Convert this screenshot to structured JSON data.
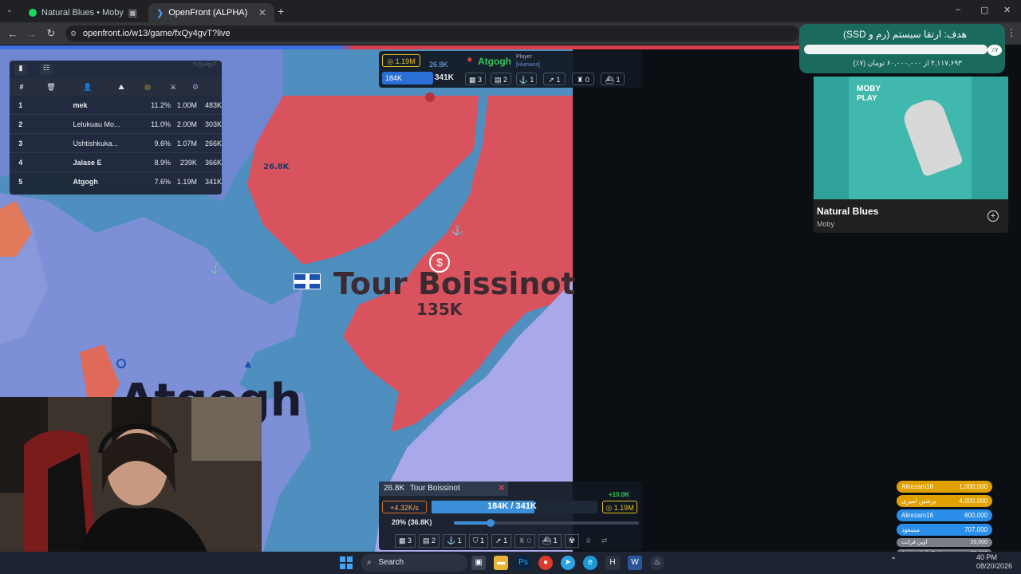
{
  "browser": {
    "tabs": [
      {
        "title": "Natural Blues • Moby",
        "active": false
      },
      {
        "title": "OpenFront (ALPHA)",
        "active": true
      }
    ],
    "new_tab": "+",
    "url": "openfront.io/w13/game/fxQy4gvT?live",
    "window_controls": [
      "–",
      "▢",
      "✕"
    ]
  },
  "leaderboard": {
    "game_id": "fxQy4gvT",
    "columns": [
      "#",
      "",
      "",
      "",
      "",
      ""
    ],
    "rows": [
      {
        "rank": "1",
        "name": "mek",
        "pct": "11.2%",
        "gold": "1.00M",
        "troops": "483K"
      },
      {
        "rank": "2",
        "name": "Lelukuau Mo...",
        "pct": "11.0%",
        "gold": "2.00M",
        "troops": "303K"
      },
      {
        "rank": "3",
        "name": "Ushtishkuka...",
        "pct": "9.6%",
        "gold": "1.07M",
        "troops": "266K"
      },
      {
        "rank": "4",
        "name": "Jalase E",
        "pct": "8.9%",
        "gold": "239K",
        "troops": "366K"
      },
      {
        "rank": "5",
        "name": "Atgogh",
        "pct": "7.6%",
        "gold": "1.19M",
        "troops": "341K"
      }
    ]
  },
  "topbar": {
    "gold": "1.19M",
    "troops_rate": "26.8K",
    "player_name": "Atgogh",
    "player_type": "Player",
    "player_sub": "[Humans]",
    "troops": "184K",
    "max_troops": "341K",
    "counts": [
      "3",
      "2",
      "1",
      "1",
      "0",
      "1"
    ]
  },
  "map": {
    "territory_name": "Tour Boissinot",
    "territory_troops": "135K",
    "player_label": "Atgogh",
    "small_label": "26.8K"
  },
  "control": {
    "target_troops": "26.8K",
    "target_name": "Tour Boissinot",
    "income": "+10.0K",
    "rate": "+4.32K/s",
    "troop_ratio": "184K / 341K",
    "gold": "1.19M",
    "attack_ratio": "20% (36.8K)",
    "attack_fraction": 0.2,
    "counts": [
      "3",
      "2",
      "1",
      "1",
      "1",
      "0",
      "1"
    ]
  },
  "goal_widget": {
    "title": "هدف: ارتقا سیستم (رم و SSD)",
    "percent": "٪۷",
    "amount": "۴,۱۱۷,۶۹۳ از ۶۰,۰۰۰,۰۰۰ تومان (۷٪)",
    "progress": 0.07
  },
  "spotify": {
    "album_artist": "MOBY",
    "album_title": "PLAY",
    "track": "Natural Blues",
    "artist": "Moby"
  },
  "donors": [
    {
      "name": "Alirezam16",
      "amount": "1,000,000",
      "color": "#e0a100"
    },
    {
      "name": "پرشین امیری",
      "amount": "4,000,000",
      "color": "#e0a100"
    },
    {
      "name": "Alirezam16",
      "amount": "600,000",
      "color": "#2a8ee8"
    },
    {
      "name": "مسعود",
      "amount": "707,000",
      "color": "#2a8ee8"
    },
    {
      "name": "اوین فرانت",
      "amount": "20,000",
      "color": "#7a7f88"
    },
    {
      "name": "Amirmahdi_Rml",
      "amount": "20,000",
      "color": "#7a7f88"
    }
  ],
  "taskbar": {
    "search": "Search",
    "time": "40 PM",
    "date": "08/20/2026"
  },
  "colors": {
    "red_territory": "#d9535f",
    "blue_water": "#4f8fc0",
    "blue_land": "#7d8fd6",
    "lavender_land": "#a9a8e8",
    "goal_bg": "#1b6a5e"
  }
}
